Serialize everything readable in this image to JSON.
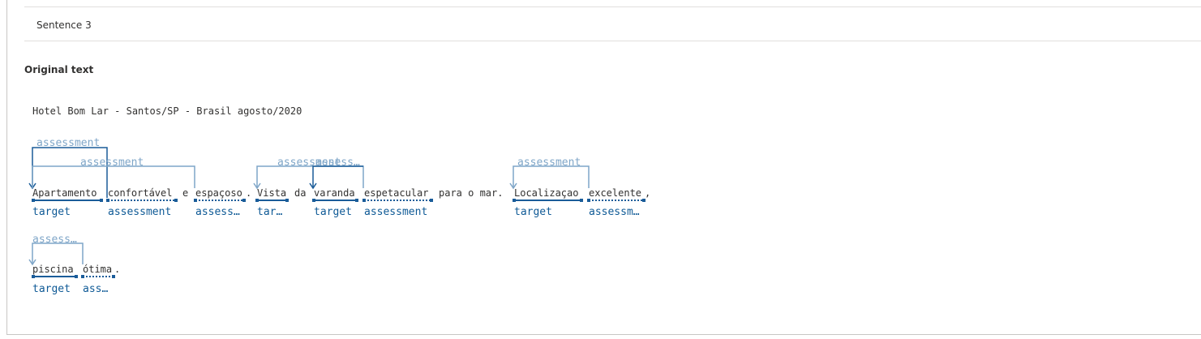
{
  "header": {
    "sentence_label": "Sentence 3"
  },
  "section": {
    "title": "Original text"
  },
  "text": {
    "line1": "Hotel Bom Lar - Santos/SP - Brasil agosto/2020",
    "tokens": {
      "apartamento": "Apartamento",
      "confortavel": "confortável",
      "e": "e",
      "espacoso": "espaçoso",
      "dot1": ".",
      "vista": "Vista",
      "da": "da",
      "varanda": "varanda",
      "espetacular": "espetacular",
      "para_o_mar": "para o mar.",
      "localizacao": "Localizaçao",
      "excelente": "excelente",
      "comma": ",",
      "piscina": "piscina",
      "otima": "ótima",
      "dot2": "."
    }
  },
  "labels": {
    "apartamento": "target",
    "confortavel": "assessment",
    "espacoso": "assess…",
    "vista": "tar…",
    "varanda": "target",
    "espetacular": "assessment",
    "localizacao": "target",
    "excelente": "assessm…",
    "piscina": "target",
    "otima": "ass…"
  },
  "arc_labels": {
    "a1": "assessment",
    "a2": "assessment",
    "a3": "assessment",
    "a4": "assess…",
    "a5": "assessment",
    "a6": "assess…"
  },
  "colors": {
    "target_line": "#1a5c99",
    "assessment_line": "#1a5c99",
    "arc": "#7fa6c8",
    "arc_dark": "#1a5c99"
  }
}
